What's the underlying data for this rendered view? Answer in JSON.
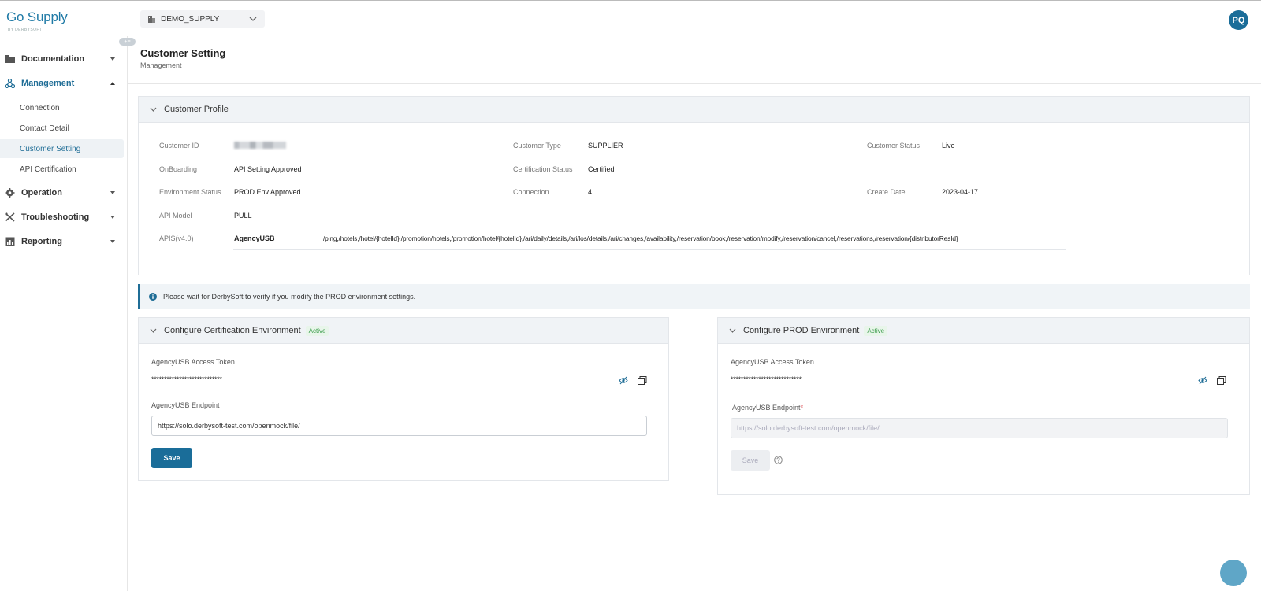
{
  "brand": {
    "name": "Go Supply",
    "tagline": "BY DERBYSOFT"
  },
  "tenant_selector": {
    "value": "DEMO_SUPPLY"
  },
  "user": {
    "initials": "PQ"
  },
  "sidebar": {
    "collapse_label": "+≡",
    "groups": [
      {
        "label": "Documentation",
        "icon": "folder-icon"
      },
      {
        "label": "Management",
        "icon": "network-icon",
        "expanded": true,
        "items": [
          "Connection",
          "Contact Detail",
          "Customer Setting",
          "API Certification"
        ]
      },
      {
        "label": "Operation",
        "icon": "gear-icon"
      },
      {
        "label": "Troubleshooting",
        "icon": "tools-icon"
      },
      {
        "label": "Reporting",
        "icon": "chart-icon"
      }
    ],
    "selected_item": "Customer Setting"
  },
  "page": {
    "title": "Customer Setting",
    "breadcrumb": "Management"
  },
  "profile": {
    "header": "Customer Profile",
    "customer_id_label": "Customer ID",
    "customer_type_label": "Customer Type",
    "customer_type": "SUPPLIER",
    "customer_status_label": "Customer Status",
    "customer_status": "Live",
    "onboarding_label": "OnBoarding",
    "onboarding": "API Setting Approved",
    "cert_status_label": "Certification Status",
    "cert_status": "Certified",
    "env_status_label": "Environment Status",
    "env_status": "PROD Env Approved",
    "connection_label": "Connection",
    "connection": "4",
    "create_date_label": "Create Date",
    "create_date": "2023-04-17",
    "api_model_label": "API Model",
    "api_model": "PULL",
    "apis_label": "APIS(v4.0)",
    "apis_name": "AgencyUSB",
    "apis_paths": "/ping,/hotels,/hotel/{hotelId},/promotion/hotels,/promotion/hotel/{hotelId},/ari/daily/details,/ari/los/details,/ari/changes,/availability,/reservation/book,/reservation/modify,/reservation/cancel,/reservations,/reservation/{distributorResId}"
  },
  "notice": {
    "text": "Please wait for DerbySoft to verify if you modify the PROD environment settings."
  },
  "cert_env": {
    "header": "Configure Certification Environment",
    "badge": "Active",
    "token_label": "AgencyUSB Access Token",
    "token_value": "****************************",
    "endpoint_label": "AgencyUSB Endpoint",
    "endpoint_value": "https://solo.derbysoft-test.com/openmock/file/",
    "save_label": "Save"
  },
  "prod_env": {
    "header": "Configure PROD Environment",
    "badge": "Active",
    "token_label": "AgencyUSB Access Token",
    "token_value": "****************************",
    "endpoint_label": "AgencyUSB Endpoint",
    "required_mark": "*",
    "endpoint_placeholder": "https://solo.derbysoft-test.com/openmock/file/",
    "save_label": "Save"
  },
  "colors": {
    "brand": "#1a6d99",
    "active_badge": "#3a9b4a",
    "panel_head": "#f0f3f6"
  }
}
